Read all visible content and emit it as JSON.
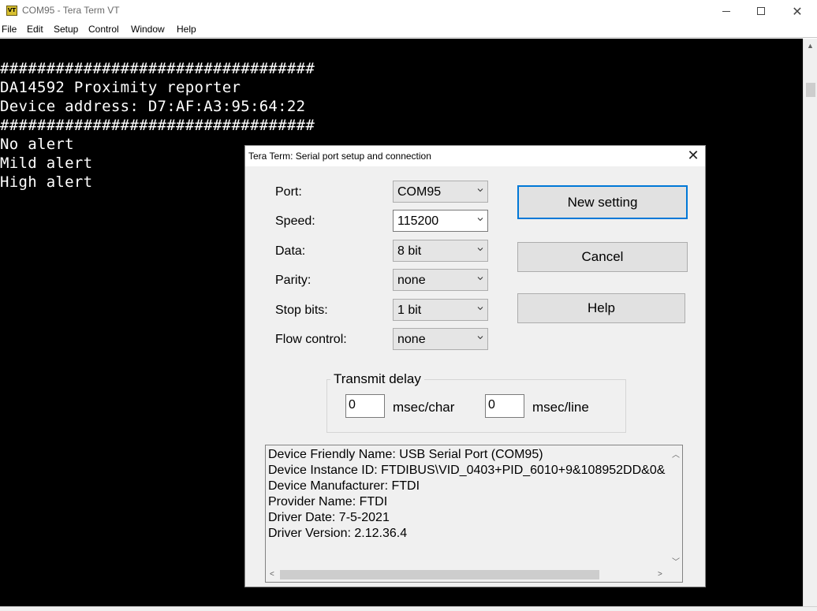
{
  "window": {
    "title": "COM95 - Tera Term VT",
    "icon_label": "VT",
    "controls": {
      "minimize": "–",
      "maximize": "□",
      "close": "✕"
    }
  },
  "menu": [
    "File",
    "Edit",
    "Setup",
    "Control",
    "Window",
    "Help"
  ],
  "terminal": {
    "lines": [
      "##################################",
      "DA14592 Proximity reporter",
      "Device address: D7:AF:A3:95:64:22",
      "##################################",
      "No alert",
      "Mild alert",
      "High alert"
    ]
  },
  "dialog": {
    "title": "Tera Term: Serial port setup and connection",
    "close": "✕",
    "fields": [
      {
        "label": "Port:",
        "value": "COM95"
      },
      {
        "label": "Speed:",
        "value": "115200"
      },
      {
        "label": "Data:",
        "value": "8 bit"
      },
      {
        "label": "Parity:",
        "value": "none"
      },
      {
        "label": "Stop bits:",
        "value": "1 bit"
      },
      {
        "label": "Flow control:",
        "value": "none"
      }
    ],
    "buttons": {
      "new_setting": "New setting",
      "cancel": "Cancel",
      "help": "Help"
    },
    "transmit_delay": {
      "title": "Transmit delay",
      "char_value": "0",
      "char_unit": "msec/char",
      "line_value": "0",
      "line_unit": "msec/line"
    },
    "info": [
      "Device Friendly Name: USB Serial Port (COM95)",
      "Device Instance ID: FTDIBUS\\VID_0403+PID_6010+9&108952DD&0&",
      "Device Manufacturer: FTDI",
      "Provider Name: FTDI",
      "Driver Date: 7-5-2021",
      "Driver Version: 2.12.36.4"
    ]
  }
}
